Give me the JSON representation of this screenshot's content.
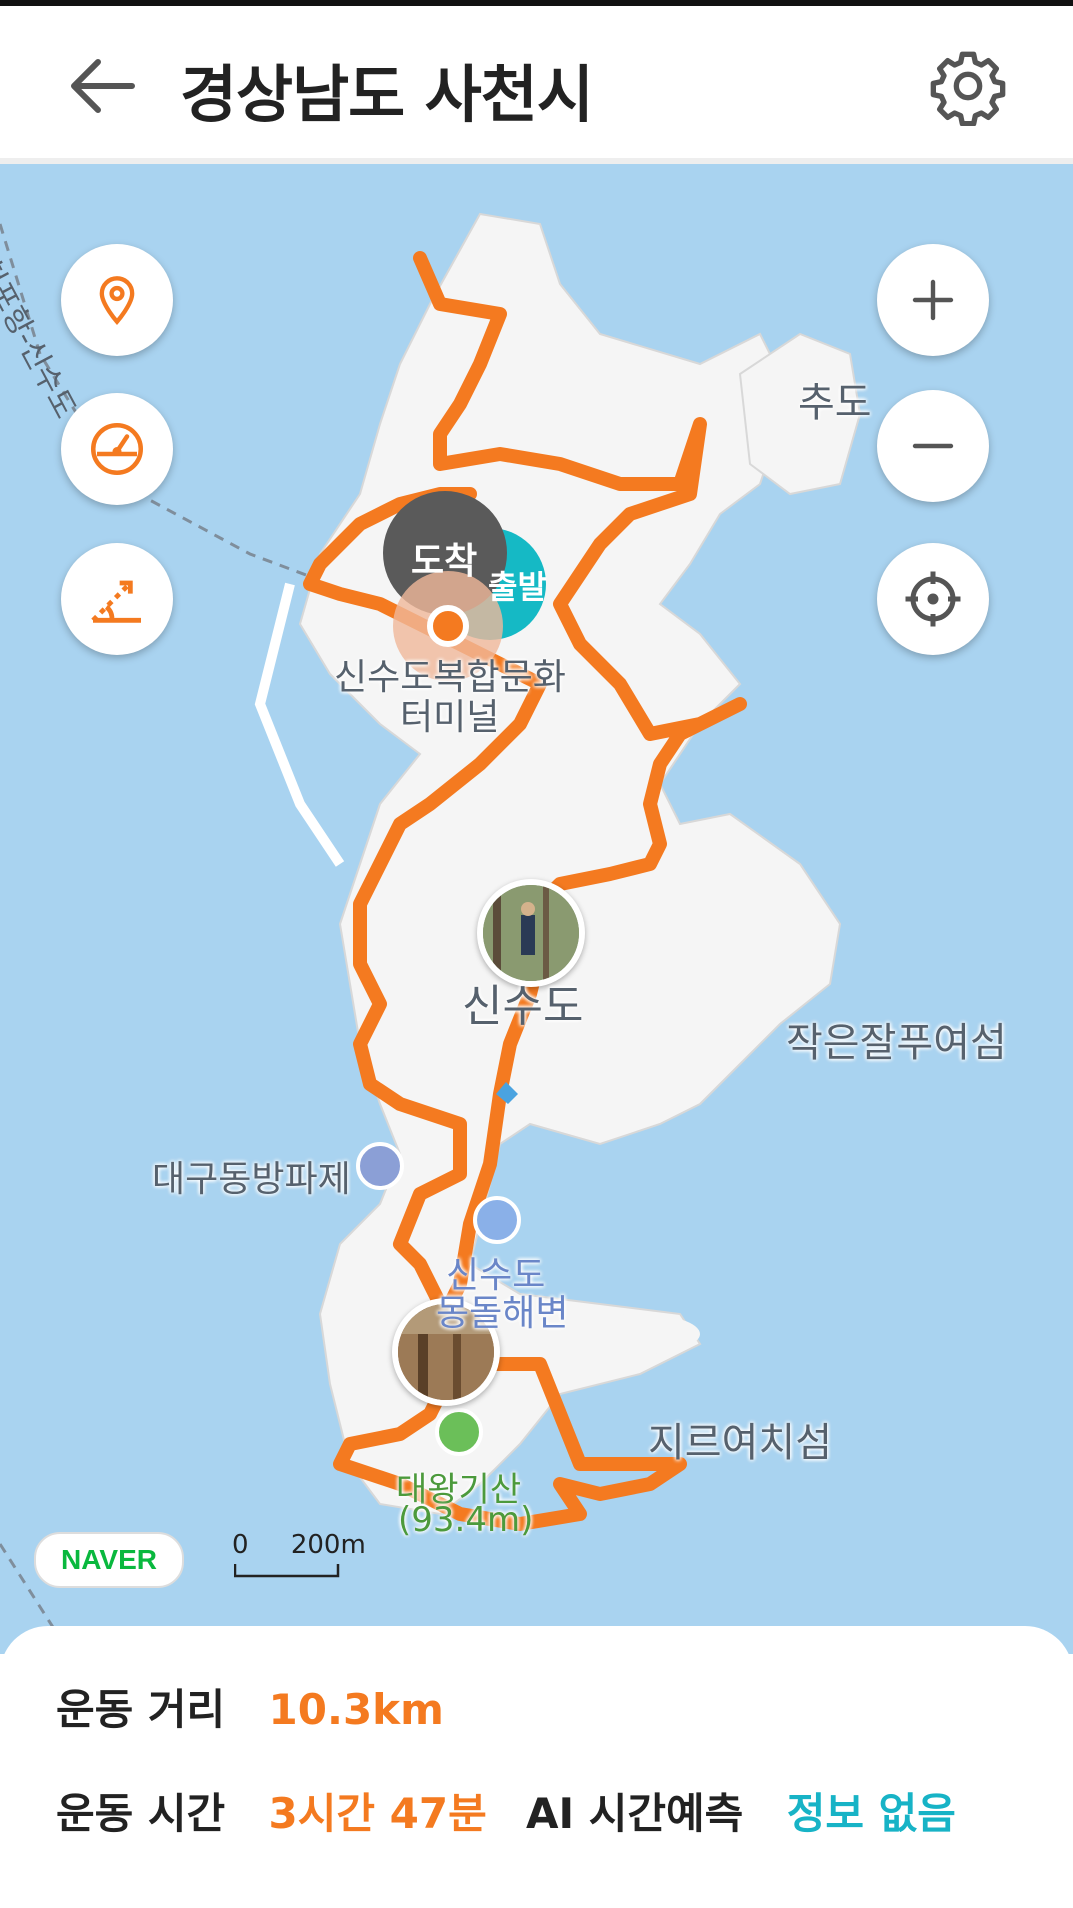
{
  "header": {
    "title": "경상남도 사천시",
    "back_icon": "arrow-left-icon",
    "settings_icon": "gear-icon"
  },
  "map": {
    "labels": {
      "ferry_route": "삼천포항-신수도",
      "chudo": "추도",
      "terminal_line1": "신수도복합문화",
      "terminal_line2": "터미널",
      "sinsudo": "신수도",
      "jageun": "작은잘푸여섬",
      "daegudong": "대구동방파제",
      "beach_line1": "신수도",
      "beach_line2": "몽돌해변",
      "jireuyeochi": "지르여치섬",
      "daewang_line1": "대왕기산",
      "daewang_line2": "(93.4m)"
    },
    "arrival_label": "도착",
    "start_label": "출발",
    "naver_logo": "NAVER",
    "scale": {
      "zero": "0",
      "distance": "200m"
    },
    "route_color": "#f47a20",
    "water_color": "#a9d3f0",
    "land_color": "#f4f4f4"
  },
  "left_controls": [
    "location-pin-icon",
    "speedometer-icon",
    "elevation-slope-icon"
  ],
  "right_controls": [
    "zoom-in-icon",
    "zoom-out-icon",
    "my-location-icon"
  ],
  "stats": {
    "distance_label": "운동 거리",
    "distance_value": "10.3km",
    "time_label": "운동 시간",
    "time_value": "3시간 47분",
    "ai_label": "AI 시간예측",
    "ai_value": "정보 없음"
  },
  "colors": {
    "accent": "#f47a20",
    "teal": "#17b3c6",
    "arrival": "#555555"
  }
}
